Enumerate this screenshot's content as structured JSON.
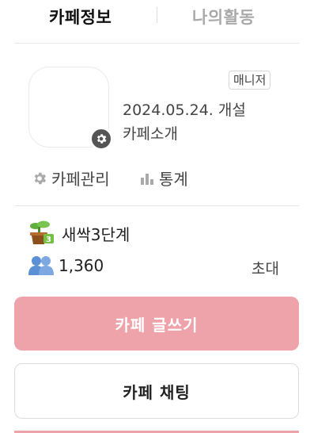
{
  "tabs": {
    "cafe_info": "카페정보",
    "my_activity": "나의활동"
  },
  "profile": {
    "role_badge": "매니저",
    "created": "2024.05.24. 개설",
    "intro_link": "카페소개"
  },
  "links": {
    "manage": "카페관리",
    "stats": "통계"
  },
  "level": {
    "label": "새싹3단계",
    "icon": "sprout-pot-icon"
  },
  "members": {
    "count": "1,360",
    "icon": "members-icon"
  },
  "invite": "초대",
  "buttons": {
    "write": "카페 글쓰기",
    "chat": "카페 채팅"
  },
  "colors": {
    "accent": "#eea3aa",
    "icon_gray": "#aaaaaa"
  }
}
